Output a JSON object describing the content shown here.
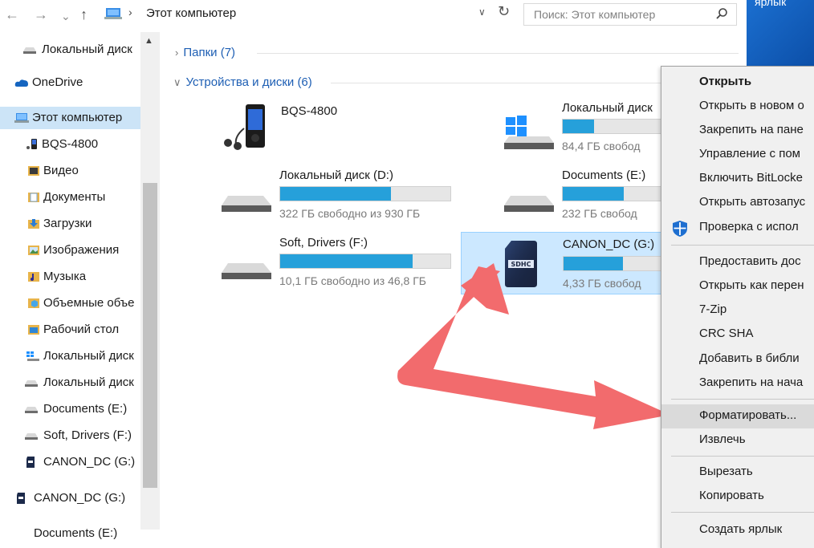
{
  "addressbar": {
    "back_label": "←",
    "forward_label": "→",
    "recent_label": "⌄",
    "up_label": "↑",
    "path_text": "Этот компьютер",
    "search_placeholder": "Поиск: Этот компьютер"
  },
  "desktop_strip": {
    "text": "ярлык"
  },
  "sidebar": {
    "items": [
      {
        "label": "Локальный диск",
        "icon": "drive-icon"
      },
      {
        "label": "OneDrive",
        "icon": "onedrive-icon"
      },
      {
        "label": "Этот компьютер",
        "icon": "computer-icon"
      },
      {
        "label": "BQS-4800",
        "icon": "phone-icon"
      },
      {
        "label": "Видео",
        "icon": "video-folder-icon"
      },
      {
        "label": "Документы",
        "icon": "documents-folder-icon"
      },
      {
        "label": "Загрузки",
        "icon": "downloads-folder-icon"
      },
      {
        "label": "Изображения",
        "icon": "pictures-folder-icon"
      },
      {
        "label": "Музыка",
        "icon": "music-folder-icon"
      },
      {
        "label": "Объемные объе",
        "icon": "3d-folder-icon"
      },
      {
        "label": "Рабочий стол",
        "icon": "desktop-folder-icon"
      },
      {
        "label": "Локальный диск",
        "icon": "windows-drive-icon"
      },
      {
        "label": "Локальный диск",
        "icon": "drive-icon"
      },
      {
        "label": "Documents (E:)",
        "icon": "drive-icon"
      },
      {
        "label": "Soft, Drivers (F:)",
        "icon": "drive-icon"
      },
      {
        "label": "CANON_DC (G:)",
        "icon": "sd-card-icon"
      },
      {
        "label": "CANON_DC (G:)",
        "icon": "sd-card-icon"
      },
      {
        "label": "Documents (E:)",
        "icon": "drive-icon"
      }
    ]
  },
  "main": {
    "folders_group": "Папки (7)",
    "devices_group": "Устройства и диски (6)",
    "devices": [
      {
        "name": "BQS-4800",
        "free": "",
        "used_fraction": null
      },
      {
        "name": "Локальный диск",
        "free": "84,4 ГБ свобод",
        "used_fraction": 0.28
      },
      {
        "name": "Локальный диск (D:)",
        "free": "322 ГБ свободно из 930 ГБ",
        "used_fraction": 0.65
      },
      {
        "name": "Documents (E:)",
        "free": "232 ГБ свобод",
        "used_fraction": 0.55
      },
      {
        "name": "Soft, Drivers (F:)",
        "free": "10,1 ГБ свободно из 46,8 ГБ",
        "used_fraction": 0.78
      },
      {
        "name": "CANON_DC (G:)",
        "free": "4,33 ГБ свобод",
        "used_fraction": 0.6
      }
    ]
  },
  "context_menu": {
    "items": [
      {
        "label": "Открыть",
        "bold": true
      },
      {
        "label": "Открыть в новом о"
      },
      {
        "label": "Закрепить на пане"
      },
      {
        "label": "Управление с пом"
      },
      {
        "label": "Включить BitLocke"
      },
      {
        "label": "Открыть автозапус"
      },
      {
        "label": "Проверка с испол"
      },
      {
        "label": "Предоставить дос"
      },
      {
        "label": "Открыть как перен"
      },
      {
        "label": "7-Zip"
      },
      {
        "label": "CRC SHA"
      },
      {
        "label": "Добавить в библи"
      },
      {
        "label": "Закрепить на нача"
      },
      {
        "label": "Форматировать..."
      },
      {
        "label": "Извлечь"
      },
      {
        "label": "Вырезать"
      },
      {
        "label": "Копировать"
      },
      {
        "label": "Создать ярлык"
      }
    ]
  },
  "colors": {
    "accent": "#26a0da",
    "selection": "#cce8ff",
    "annotation_arrow": "#f46c6c"
  }
}
